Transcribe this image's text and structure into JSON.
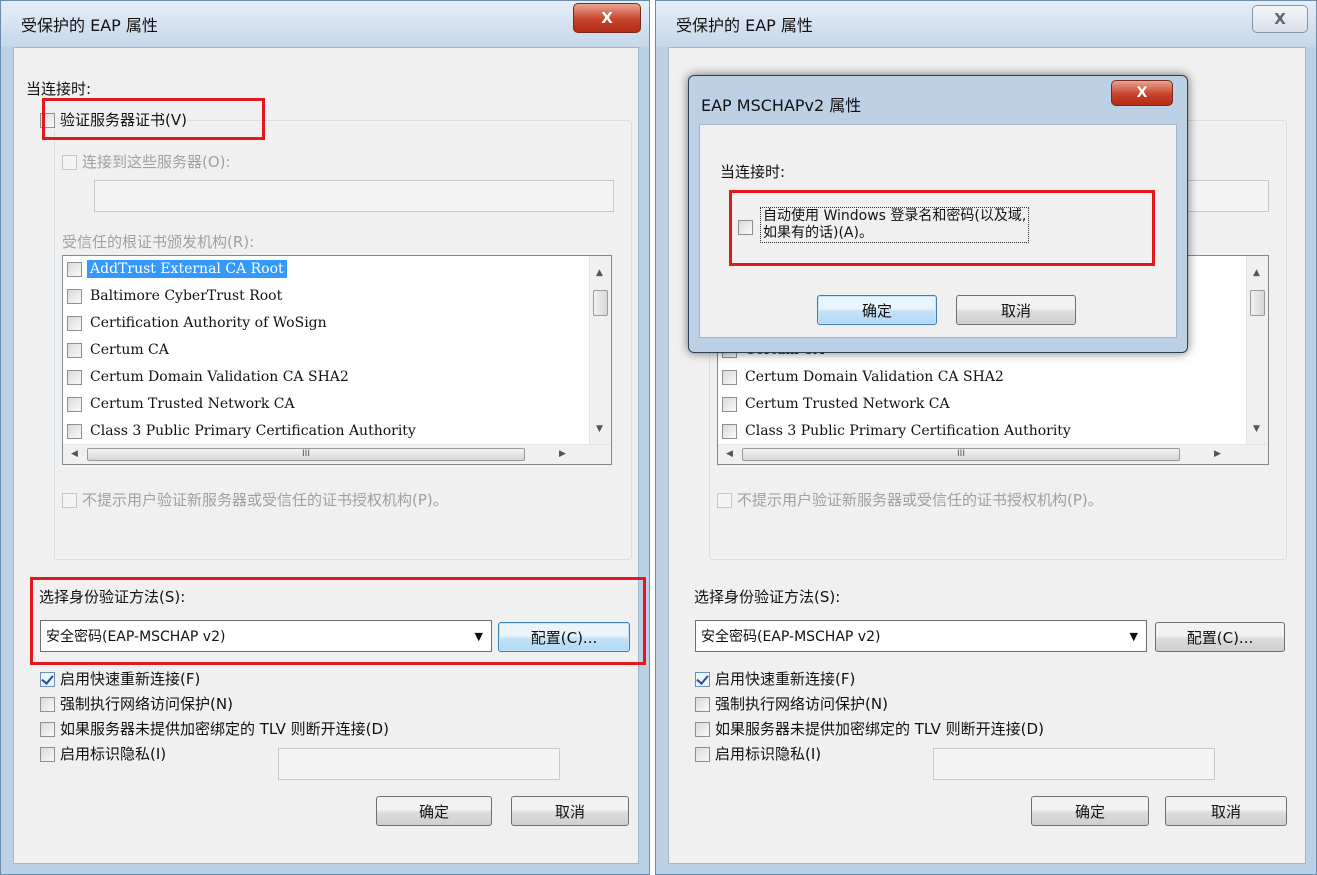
{
  "window_left": {
    "title": "受保护的 EAP 属性",
    "close_glyph": "X",
    "when_connecting": "当连接时:",
    "verify_cert": "验证服务器证书(V)",
    "connect_servers": "连接到这些服务器(O):",
    "trusted_roots": "受信任的根证书颁发机构(R):",
    "certs": [
      "AddTrust External CA Root",
      "Baltimore CyberTrust Root",
      "Certification Authority of WoSign",
      "Certum CA",
      "Certum Domain Validation CA SHA2",
      "Certum Trusted Network CA",
      "Class 3 Public Primary Certification Authority"
    ],
    "scroll_grip": "III",
    "no_prompt": "不提示用户验证新服务器或受信任的证书授权机构(P)。",
    "select_auth": "选择身份验证方法(S):",
    "auth_method": "安全密码(EAP-MSCHAP v2)",
    "configure": "配置(C)...",
    "fast_reconnect": "启用快速重新连接(F)",
    "enforce_nap": "强制执行网络访问保护(N)",
    "disconnect_tlv": "如果服务器未提供加密绑定的 TLV 则断开连接(D)",
    "identity_privacy": "启用标识隐私(I)",
    "ok": "确定",
    "cancel": "取消"
  },
  "window_right": {
    "title": "受保护的 EAP 属性",
    "close_glyph": "X",
    "certs_visible": [
      "Certum CA",
      "Certum Domain Validation CA SHA2",
      "Certum Trusted Network CA",
      "Class 3 Public Primary Certification Authority"
    ],
    "scroll_grip": "III",
    "no_prompt": "不提示用户验证新服务器或受信任的证书授权机构(P)。",
    "select_auth": "选择身份验证方法(S):",
    "auth_method": "安全密码(EAP-MSCHAP v2)",
    "configure": "配置(C)...",
    "fast_reconnect": "启用快速重新连接(F)",
    "enforce_nap": "强制执行网络访问保护(N)",
    "disconnect_tlv": "如果服务器未提供加密绑定的 TLV 则断开连接(D)",
    "identity_privacy": "启用标识隐私(I)",
    "ok": "确定",
    "cancel": "取消"
  },
  "dialog": {
    "title": "EAP MSCHAPv2 属性",
    "close_glyph": "X",
    "when_connecting": "当连接时:",
    "auto_use_line1": "自动使用 Windows 登录名和密码(以及域,",
    "auto_use_line2": "如果有的话)(A)。",
    "ok": "确定",
    "cancel": "取消"
  }
}
